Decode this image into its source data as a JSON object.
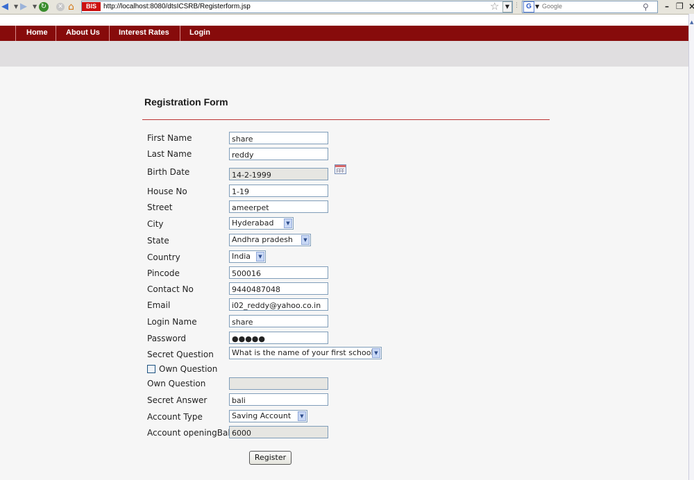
{
  "browser": {
    "favicon_text": "BIS",
    "url": "http://localhost:8080/dtsICSRB/Registerform.jsp",
    "search_placeholder": "Google",
    "google_letter": "G"
  },
  "nav": {
    "items": [
      "Home",
      "About Us",
      "Interest Rates",
      "Login"
    ]
  },
  "form": {
    "title": "Registration Form",
    "fields": {
      "first_name": {
        "label": "First Name",
        "value": "share"
      },
      "last_name": {
        "label": "Last Name",
        "value": "reddy"
      },
      "birth_date": {
        "label": "Birth Date",
        "value": "14-2-1999"
      },
      "house_no": {
        "label": "House No",
        "value": "1-19"
      },
      "street": {
        "label": "Street",
        "value": "ameerpet"
      },
      "city": {
        "label": "City",
        "value": "Hyderabad"
      },
      "state": {
        "label": "State",
        "value": "Andhra pradesh"
      },
      "country": {
        "label": "Country",
        "value": "India"
      },
      "pincode": {
        "label": "Pincode",
        "value": "500016"
      },
      "contact_no": {
        "label": "Contact No",
        "value": "9440487048"
      },
      "email": {
        "label": "Email",
        "value": "i02_reddy@yahoo.co.in"
      },
      "login_name": {
        "label": "Login Name",
        "value": "share"
      },
      "password": {
        "label": "Password",
        "value": "●●●●●"
      },
      "secret_question": {
        "label": "Secret Question",
        "value": "What is the name of your first school?"
      },
      "own_question_check": {
        "label": "Own Question"
      },
      "own_question": {
        "label": "Own Question",
        "value": ""
      },
      "secret_answer": {
        "label": "Secret Answer",
        "value": "bali"
      },
      "account_type": {
        "label": "Account Type",
        "value": "Saving Account"
      },
      "opening_bal": {
        "label": "Account openingBal",
        "value": "6000"
      }
    },
    "register_label": "Register"
  },
  "colors": {
    "nav_bg": "#870b0b",
    "rule": "#bb3333",
    "input_border": "#7f9db9"
  }
}
